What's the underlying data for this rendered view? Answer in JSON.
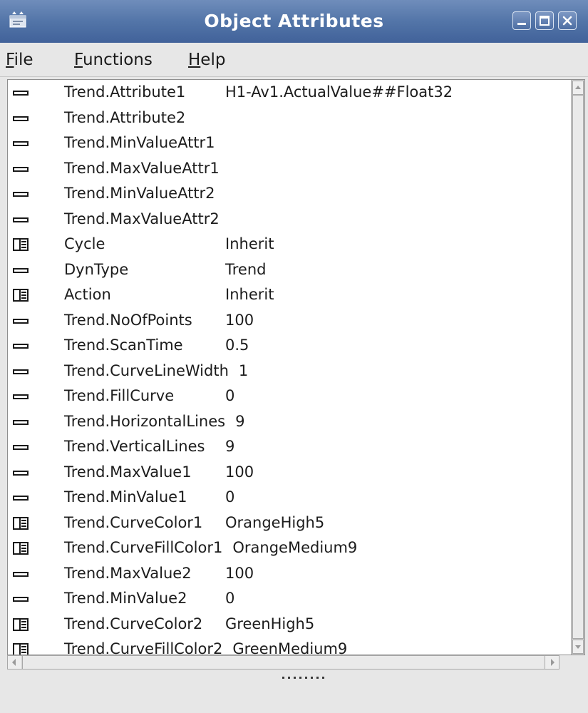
{
  "window": {
    "title": "Object Attributes",
    "app_icon": "app-window-icon",
    "controls": [
      "minimize-icon",
      "maximize-icon",
      "close-icon"
    ]
  },
  "menubar": {
    "items": [
      {
        "mnemonic": "F",
        "rest": "ile"
      },
      {
        "mnemonic": "F",
        "rest": "unctions"
      },
      {
        "mnemonic": "H",
        "rest": "elp"
      }
    ]
  },
  "attributes": [
    {
      "name": "Trend.Attribute1",
      "value": "H1-Av1.ActualValue##Float32",
      "icon": "attribute-icon",
      "value_x": 305
    },
    {
      "name": "Trend.Attribute2",
      "value": "",
      "icon": "attribute-icon"
    },
    {
      "name": "Trend.MinValueAttr1",
      "value": "",
      "icon": "attribute-icon"
    },
    {
      "name": "Trend.MaxValueAttr1",
      "value": "",
      "icon": "attribute-icon"
    },
    {
      "name": "Trend.MinValueAttr2",
      "value": "",
      "icon": "attribute-icon"
    },
    {
      "name": "Trend.MaxValueAttr2",
      "value": "",
      "icon": "attribute-icon"
    },
    {
      "name": "Cycle",
      "value": "Inherit",
      "icon": "enum-attribute-icon"
    },
    {
      "name": "DynType",
      "value": "Trend",
      "icon": "attribute-icon"
    },
    {
      "name": "Action",
      "value": "Inherit",
      "icon": "enum-attribute-icon"
    },
    {
      "name": "Trend.NoOfPoints",
      "value": "100",
      "icon": "attribute-icon"
    },
    {
      "name": "Trend.ScanTime",
      "value": "0.5",
      "icon": "attribute-icon"
    },
    {
      "name": "Trend.CurveLineWidth",
      "value": "1",
      "icon": "attribute-icon"
    },
    {
      "name": "Trend.FillCurve",
      "value": "0",
      "icon": "attribute-icon"
    },
    {
      "name": "Trend.HorizontalLines",
      "value": "9",
      "icon": "attribute-icon"
    },
    {
      "name": "Trend.VerticalLines",
      "value": "9",
      "icon": "attribute-icon"
    },
    {
      "name": "Trend.MaxValue1",
      "value": "100",
      "icon": "attribute-icon"
    },
    {
      "name": "Trend.MinValue1",
      "value": "0",
      "icon": "attribute-icon"
    },
    {
      "name": "Trend.CurveColor1",
      "value": "OrangeHigh5",
      "icon": "enum-attribute-icon"
    },
    {
      "name": "Trend.CurveFillColor1",
      "value": "OrangeMedium9",
      "icon": "enum-attribute-icon"
    },
    {
      "name": "Trend.MaxValue2",
      "value": "100",
      "icon": "attribute-icon"
    },
    {
      "name": "Trend.MinValue2",
      "value": "0",
      "icon": "attribute-icon"
    },
    {
      "name": "Trend.CurveColor2",
      "value": "GreenHigh5",
      "icon": "enum-attribute-icon"
    },
    {
      "name": "Trend.CurveFillColor2",
      "value": "GreenMedium9",
      "icon": "enum-attribute-icon"
    }
  ],
  "colors": {
    "titlebar": "#5375a8",
    "window_bg": "#e7e7e7",
    "list_bg": "#ffffff",
    "text": "#1c1c1c"
  }
}
